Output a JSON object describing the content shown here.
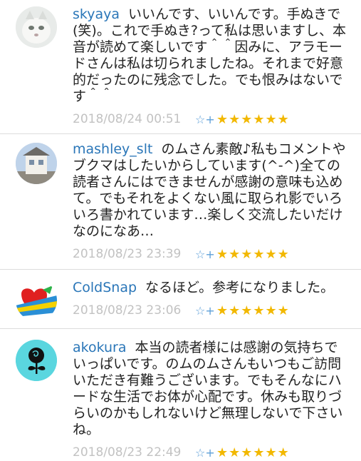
{
  "comments": [
    {
      "user": "skyaya",
      "text": "いいんです、いいんです。手ぬきで(笑)。これで手ぬき?って私は思いますし、本音が読めて楽しいです＾＾因みに、アラモードさんは私は切られましたね。それまで好意的だったのに残念でした。でも恨みはないです＾＾",
      "timestamp": "2018/08/24 00:51",
      "stars": "★★★★★★",
      "star_add_icon": "star-plus-icon"
    },
    {
      "user": "mashley_slt",
      "text": "のムさん素敵♪私もコメントやブクマはしたいからしています(^-^)全ての読者さんにはできませんが感謝の意味も込めて。でもそれをよくない風に取られ影でいろいろ書かれています…楽しく交流したいだけなのになあ…",
      "timestamp": "2018/08/23 23:39",
      "stars": "★★★★★★",
      "star_add_icon": "star-plus-icon"
    },
    {
      "user": "ColdSnap",
      "text": "なるほど。参考になりました。",
      "timestamp": "2018/08/23 23:06",
      "stars": "★★★★★★",
      "star_add_icon": "star-plus-icon"
    },
    {
      "user": "akokura",
      "text": "本当の読者様には感謝の気持ちでいっぱいです。のムのムさんもいつもご訪問いただき有難うございます。でもそんなにハードな生活でお体が心配です。休みも取りづらいのかもしれないけど無理しないで下さいね。",
      "timestamp": "2018/08/23 22:49",
      "stars": "★★★★★★",
      "star_add_icon": "star-plus-icon"
    }
  ],
  "colors": {
    "username": "#2a76b8",
    "timestamp": "#c2c2c2",
    "star": "#f2b800",
    "star_add": "#5d9fd8",
    "divider": "#dcdcdc"
  }
}
